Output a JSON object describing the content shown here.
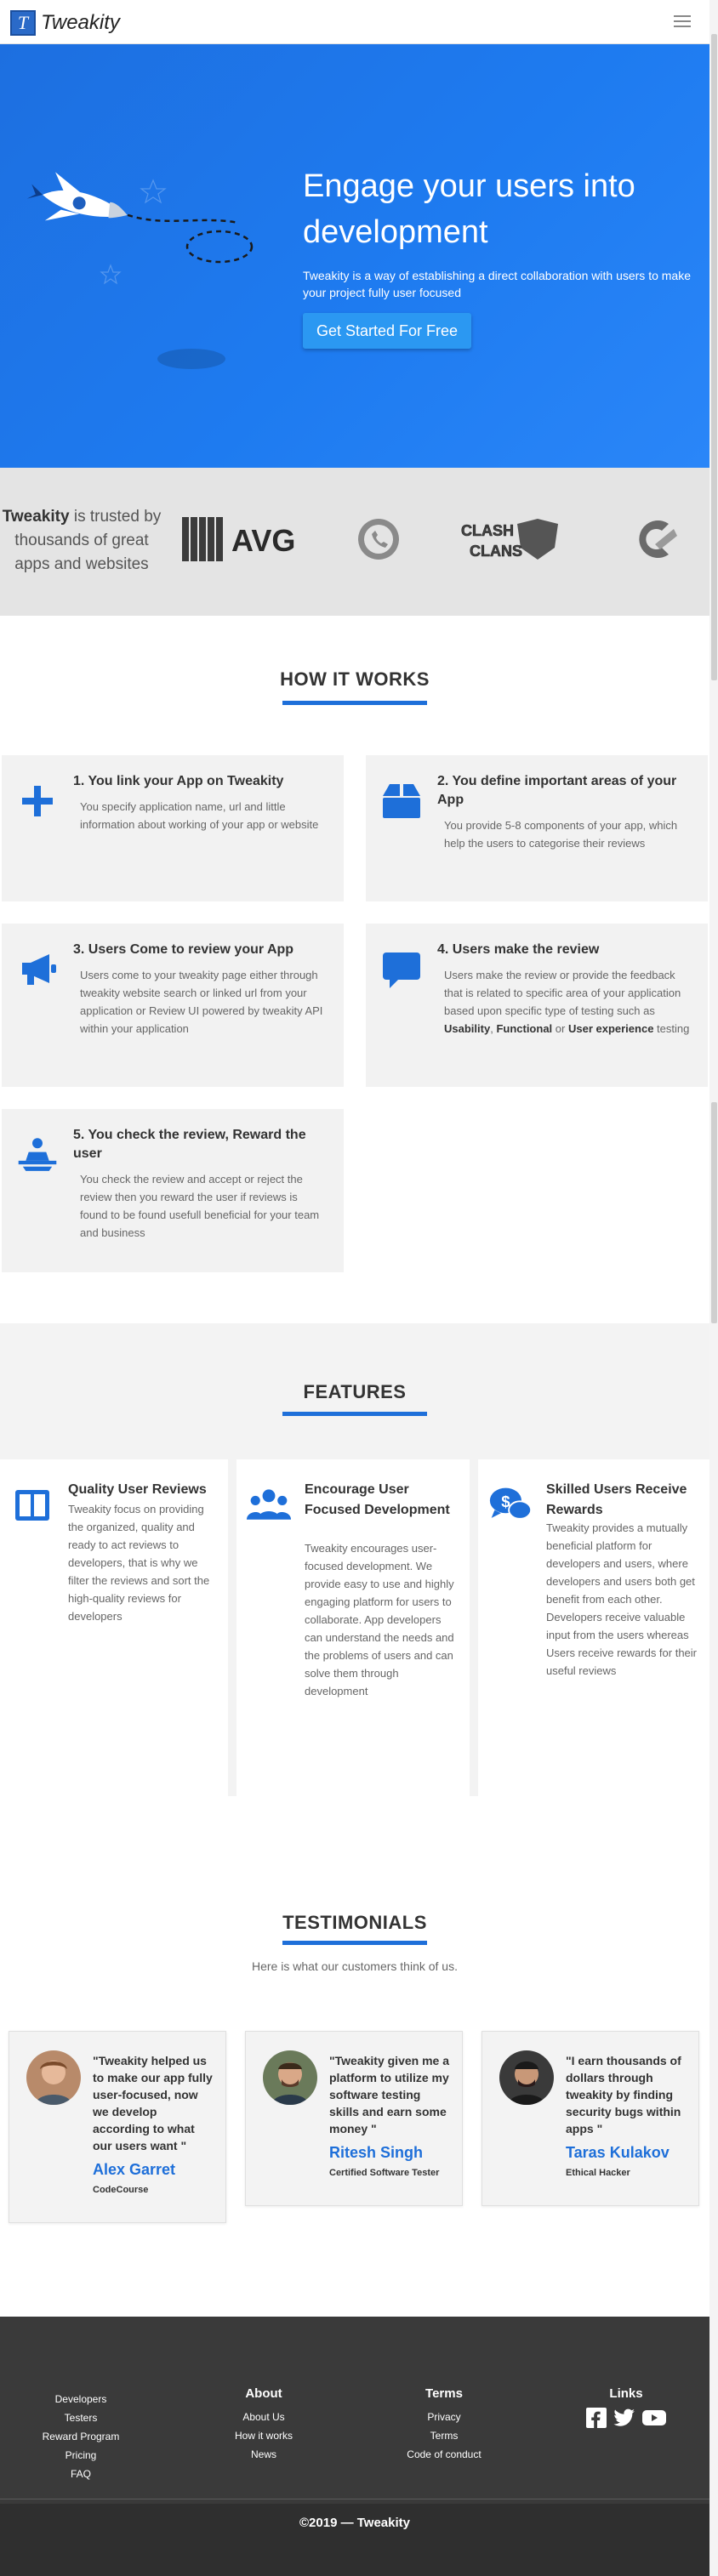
{
  "brand": {
    "logo_letter": "T",
    "name": "Tweakity"
  },
  "hero": {
    "title": "Engage your users into development",
    "subtitle": "Tweakity is a way of establishing a direct collaboration with users to make your project fully user focused",
    "cta": "Get Started For Free"
  },
  "trusted": {
    "brand": "Tweakity",
    "text": "is trusted by thousands of great apps and websites",
    "logos": [
      "AVG",
      "WhatsApp",
      "Clash of Clans",
      "CCleaner"
    ],
    "avg_label": "AVG",
    "coc_label_1": "CLASH",
    "coc_label_2": "CLANS"
  },
  "how": {
    "title": "HOW IT WORKS",
    "steps": [
      {
        "title": "1. You link your App on Tweakity",
        "icon": "plus-icon",
        "text": "You specify application name, url and little information about working of your app or website"
      },
      {
        "title": "2. You define important areas of your App",
        "icon": "box-icon",
        "text": "You provide 5-8 components of your app, which help the users to categorise their reviews"
      },
      {
        "title": "3. Users Come to review your App",
        "icon": "megaphone-icon",
        "text": "Users come to your tweakity page either through tweakity website search or linked url from your application or Review UI powered by tweakity API within your application"
      },
      {
        "title": "4. Users make the review",
        "icon": "comment-icon",
        "text_prefix": "Users make the review or provide the feedback that is related to specific area of your application based upon specific type of testing such as",
        "bold_1": "Usability",
        "sep_1": ",",
        "bold_2": "Functional",
        "sep_2": "or",
        "bold_3": "User experience",
        "text_suffix": "testing"
      },
      {
        "title": "5. You check the review, Reward the user",
        "icon": "presenter-icon",
        "text": "You check the review and accept or reject the review then you reward the user if reviews is found to be found usefull beneficial for your team and business"
      }
    ]
  },
  "features": {
    "title": "FEATURES",
    "items": [
      {
        "title": "Quality User Reviews",
        "icon": "columns-icon",
        "text": "Tweakity focus on providing the organized, quality and ready to act reviews to developers, that is why we filter the reviews and sort the high-quality reviews for developers"
      },
      {
        "title": "Encourage User Focused Development",
        "icon": "users-icon",
        "text": "Tweakity encourages user-focused development. We provide easy to use and highly engaging platform for users to collaborate. App developers can understand the needs and the problems of users and can solve them through development"
      },
      {
        "title": "Skilled Users Receive Rewards",
        "icon": "money-chat-icon",
        "text": "Tweakity provides a mutually beneficial platform for developers and users, where developers and users both get benefit from each other. Developers receive valuable input from the users whereas Users receive rewards for their useful reviews"
      }
    ]
  },
  "testimonials": {
    "title": "TESTIMONIALS",
    "subtitle": "Here is what our customers think of us.",
    "items": [
      {
        "quote": "\"Tweakity helped us to make our app fully user-focused, now we develop according to what our users want \"",
        "name": "Alex Garret",
        "role": "CodeCourse"
      },
      {
        "quote": "\"Tweakity given me a platform to utilize my software testing skills and earn some money \"",
        "name": "Ritesh Singh",
        "role": "Certified Software Tester"
      },
      {
        "quote": "\"I earn thousands of dollars through tweakity by finding security bugs within apps \"",
        "name": "Taras Kulakov",
        "role": "Ethical Hacker"
      }
    ]
  },
  "footer": {
    "col1": [
      "Developers",
      "Testers",
      "Reward Program",
      "Pricing",
      "FAQ"
    ],
    "about": {
      "title": "About",
      "links": [
        "About Us",
        "How it works",
        "News"
      ]
    },
    "terms": {
      "title": "Terms",
      "links": [
        "Privacy",
        "Terms",
        "Code of conduct"
      ]
    },
    "links": {
      "title": "Links",
      "social": [
        "facebook-icon",
        "twitter-icon",
        "youtube-icon"
      ]
    },
    "copyright": "©2019 — Tweakity"
  },
  "colors": {
    "primary": "#1e6fd9",
    "hero_start": "#1d6fe0",
    "cta": "#2b98f2",
    "footer": "#3a3a3a"
  }
}
